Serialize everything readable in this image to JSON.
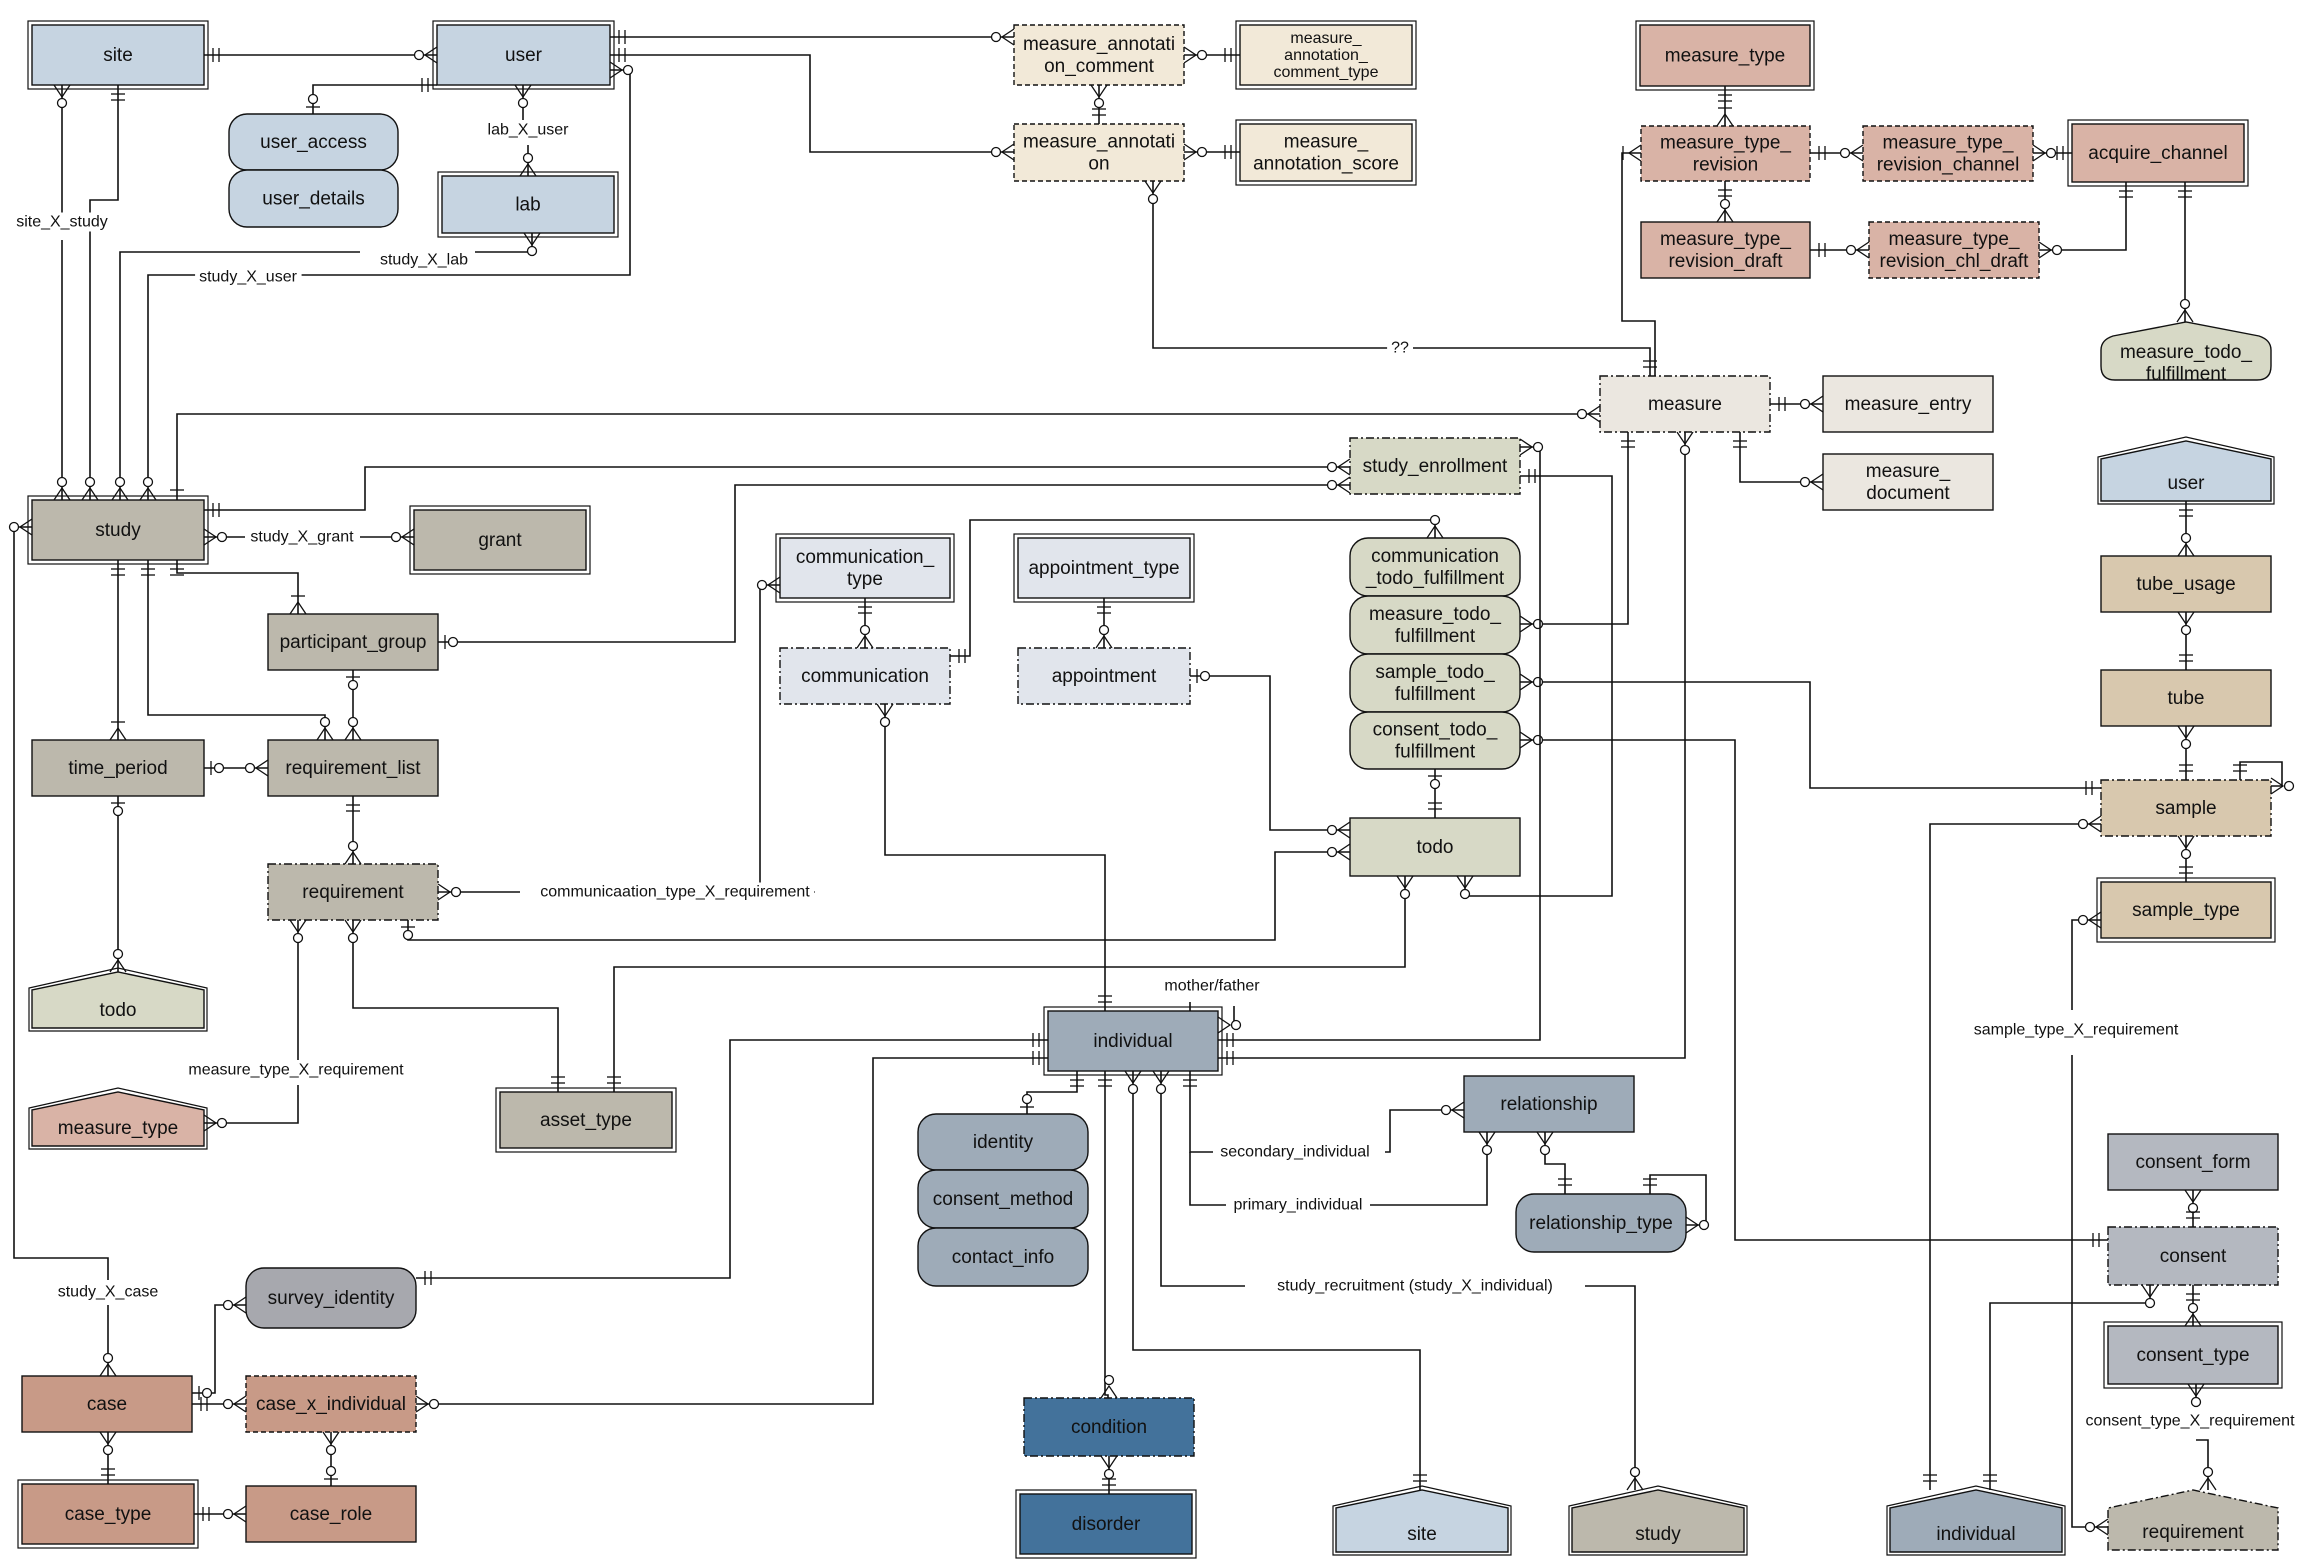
{
  "diagram": {
    "type": "entity-relationship",
    "palette": {
      "user_blue": "#c6d4e1",
      "annotation_cream": "#f2e9d8",
      "measure_type_pink": "#d9b3a6",
      "measure_gray": "#ebe7e0",
      "study_taupe": "#bcb8ac",
      "todo_sage": "#d7d9c6",
      "comm_lightblue": "#e1e5ec",
      "sample_tan": "#d8c8ae",
      "individual_slate": "#9eabb8",
      "consent_gray": "#b4b8c0",
      "case_terracotta": "#c89a87",
      "survey_gray": "#a7a8ae",
      "condition_blue": "#43729b"
    },
    "entities": [
      {
        "id": "site",
        "label": "site",
        "color": "user_blue",
        "style": "double"
      },
      {
        "id": "user",
        "label": "user",
        "color": "user_blue",
        "style": "double"
      },
      {
        "id": "user_access",
        "label": "user_access",
        "color": "user_blue",
        "style": "rounded"
      },
      {
        "id": "user_details",
        "label": "user_details",
        "color": "user_blue",
        "style": "rounded"
      },
      {
        "id": "lab",
        "label": "lab",
        "color": "user_blue",
        "style": "double"
      },
      {
        "id": "measure_annotation_comment",
        "label": "measure_annotati\non_comment",
        "color": "annotation_cream",
        "style": "dashed"
      },
      {
        "id": "measure_annotation_comment_type",
        "label": "measure_\nannotation_\ncomment_type",
        "color": "annotation_cream",
        "style": "double",
        "small": true
      },
      {
        "id": "measure_annotation",
        "label": "measure_annotati\non",
        "color": "annotation_cream",
        "style": "dashed"
      },
      {
        "id": "measure_annotation_score",
        "label": "measure_\nannotation_score",
        "color": "annotation_cream",
        "style": "double"
      },
      {
        "id": "measure_type_top",
        "label": "measure_type",
        "color": "measure_type_pink",
        "style": "double"
      },
      {
        "id": "measure_type_revision",
        "label": "measure_type_\nrevision",
        "color": "measure_type_pink",
        "style": "dashed"
      },
      {
        "id": "measure_type_revision_channel",
        "label": "measure_type_\nrevision_channel",
        "color": "measure_type_pink",
        "style": "dashed"
      },
      {
        "id": "acquire_channel",
        "label": "acquire_channel",
        "color": "measure_type_pink",
        "style": "double"
      },
      {
        "id": "measure_type_revision_draft",
        "label": "measure_type_\nrevision_draft",
        "color": "measure_type_pink",
        "style": "solid"
      },
      {
        "id": "measure_type_revision_chl_draft",
        "label": "measure_type_\nrevision_chl_draft",
        "color": "measure_type_pink",
        "style": "dashed"
      },
      {
        "id": "measure_todo_fulfillment_ref",
        "label": "measure_todo_\nfulfillment",
        "color": "todo_sage",
        "style": "ref-rounded"
      },
      {
        "id": "measure",
        "label": "measure",
        "color": "measure_gray",
        "style": "dashdot"
      },
      {
        "id": "measure_entry",
        "label": "measure_entry",
        "color": "measure_gray",
        "style": "solid"
      },
      {
        "id": "measure_document",
        "label": "measure_\ndocument",
        "color": "measure_gray",
        "style": "solid"
      },
      {
        "id": "study_enrollment",
        "label": "study_enrollment",
        "color": "todo_sage",
        "style": "dashdot"
      },
      {
        "id": "study",
        "label": "study",
        "color": "study_taupe",
        "style": "double"
      },
      {
        "id": "grant",
        "label": "grant",
        "color": "study_taupe",
        "style": "double"
      },
      {
        "id": "user_ref",
        "label": "user",
        "color": "user_blue",
        "style": "ref"
      },
      {
        "id": "participant_group",
        "label": "participant_group",
        "color": "study_taupe",
        "style": "solid"
      },
      {
        "id": "communication_type",
        "label": "communication_\ntype",
        "color": "comm_lightblue",
        "style": "double"
      },
      {
        "id": "appointment_type",
        "label": "appointment_type",
        "color": "comm_lightblue",
        "style": "double"
      },
      {
        "id": "communication_todo_fulfillment",
        "label": "communication\n_todo_fulfillment",
        "color": "todo_sage",
        "style": "rounded"
      },
      {
        "id": "measure_todo_fulfillment",
        "label": "measure_todo_\nfulfillment",
        "color": "todo_sage",
        "style": "rounded"
      },
      {
        "id": "sample_todo_fulfillment",
        "label": "sample_todo_\nfulfillment",
        "color": "todo_sage",
        "style": "rounded"
      },
      {
        "id": "consent_todo_fulfillment",
        "label": "consent_todo_\nfulfillment",
        "color": "todo_sage",
        "style": "rounded"
      },
      {
        "id": "communication",
        "label": "communication",
        "color": "comm_lightblue",
        "style": "dashdot"
      },
      {
        "id": "appointment",
        "label": "appointment",
        "color": "comm_lightblue",
        "style": "dashdot"
      },
      {
        "id": "tube_usage",
        "label": "tube_usage",
        "color": "sample_tan",
        "style": "solid"
      },
      {
        "id": "tube",
        "label": "tube",
        "color": "sample_tan",
        "style": "solid"
      },
      {
        "id": "time_period",
        "label": "time_period",
        "color": "study_taupe",
        "style": "solid"
      },
      {
        "id": "requirement_list",
        "label": "requirement_list",
        "color": "study_taupe",
        "style": "solid"
      },
      {
        "id": "sample",
        "label": "sample",
        "color": "sample_tan",
        "style": "dashdot"
      },
      {
        "id": "todo",
        "label": "todo",
        "color": "todo_sage",
        "style": "solid"
      },
      {
        "id": "requirement",
        "label": "requirement",
        "color": "study_taupe",
        "style": "dashdot"
      },
      {
        "id": "sample_type",
        "label": "sample_type",
        "color": "sample_tan",
        "style": "double"
      },
      {
        "id": "todo_ref",
        "label": "todo",
        "color": "todo_sage",
        "style": "ref"
      },
      {
        "id": "individual",
        "label": "individual",
        "color": "individual_slate",
        "style": "double"
      },
      {
        "id": "measure_type_ref",
        "label": "measure_type",
        "color": "measure_type_pink",
        "style": "ref-double"
      },
      {
        "id": "asset_type",
        "label": "asset_type",
        "color": "study_taupe",
        "style": "double"
      },
      {
        "id": "relationship",
        "label": "relationship",
        "color": "individual_slate",
        "style": "solid"
      },
      {
        "id": "identity",
        "label": "identity",
        "color": "individual_slate",
        "style": "rounded"
      },
      {
        "id": "consent_method",
        "label": "consent_method",
        "color": "individual_slate",
        "style": "rounded"
      },
      {
        "id": "contact_info",
        "label": "contact_info",
        "color": "individual_slate",
        "style": "rounded"
      },
      {
        "id": "consent_form",
        "label": "consent_form",
        "color": "consent_gray",
        "style": "solid"
      },
      {
        "id": "relationship_type",
        "label": "relationship_type",
        "color": "individual_slate",
        "style": "rounded"
      },
      {
        "id": "consent",
        "label": "consent",
        "color": "consent_gray",
        "style": "dashdot"
      },
      {
        "id": "survey_identity",
        "label": "survey_identity",
        "color": "survey_gray",
        "style": "rounded"
      },
      {
        "id": "consent_type",
        "label": "consent_type",
        "color": "consent_gray",
        "style": "double"
      },
      {
        "id": "case",
        "label": "case",
        "color": "case_terracotta",
        "style": "solid"
      },
      {
        "id": "case_x_individual",
        "label": "case_x_individual",
        "color": "case_terracotta",
        "style": "dashed"
      },
      {
        "id": "condition",
        "label": "condition",
        "color": "condition_blue",
        "style": "dashdot"
      },
      {
        "id": "case_type",
        "label": "case_type",
        "color": "case_terracotta",
        "style": "double"
      },
      {
        "id": "case_role",
        "label": "case_role",
        "color": "case_terracotta",
        "style": "solid"
      },
      {
        "id": "disorder",
        "label": "disorder",
        "color": "condition_blue",
        "style": "double"
      },
      {
        "id": "site_ref",
        "label": "site",
        "color": "user_blue",
        "style": "ref-double"
      },
      {
        "id": "study_ref",
        "label": "study",
        "color": "study_taupe",
        "style": "ref-double"
      },
      {
        "id": "individual_ref",
        "label": "individual",
        "color": "individual_slate",
        "style": "ref-double"
      },
      {
        "id": "requirement_ref",
        "label": "requirement",
        "color": "study_taupe",
        "style": "ref-dashdot"
      }
    ],
    "relationship_labels": [
      {
        "id": "lab_X_user",
        "text": "lab_X_user"
      },
      {
        "id": "site_X_study",
        "text": "site_X_study"
      },
      {
        "id": "study_X_lab",
        "text": "study_X_lab"
      },
      {
        "id": "study_X_user",
        "text": "study_X_user"
      },
      {
        "id": "qq",
        "text": "??"
      },
      {
        "id": "study_X_grant",
        "text": "study_X_grant"
      },
      {
        "id": "communicaation_type_X_requirement",
        "text": "communicaation_type_X_requirement"
      },
      {
        "id": "mother_father",
        "text": "mother/father"
      },
      {
        "id": "measure_type_X_requirement",
        "text": "measure_type_X_requirement"
      },
      {
        "id": "secondary_individual",
        "text": "secondary_individual"
      },
      {
        "id": "primary_individual",
        "text": "primary_individual"
      },
      {
        "id": "study_recruitment",
        "text": "study_recruitment (study_X_individual)"
      },
      {
        "id": "study_X_case",
        "text": "study_X_case"
      },
      {
        "id": "sample_type_X_requirement",
        "text": "sample_type_X_requirement"
      },
      {
        "id": "consent_type_X_requirement",
        "text": "consent_type_X_requirement"
      }
    ]
  }
}
